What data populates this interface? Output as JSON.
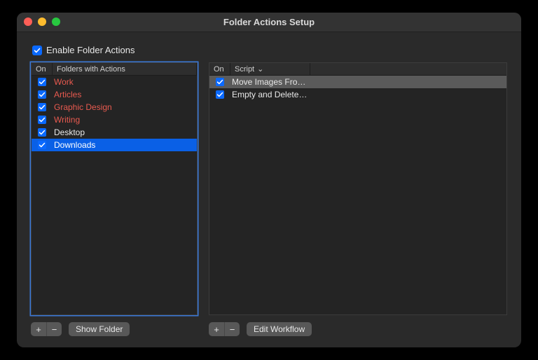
{
  "window": {
    "title": "Folder Actions Setup"
  },
  "enable": {
    "label": "Enable Folder Actions",
    "checked": true
  },
  "foldersTable": {
    "headers": {
      "on": "On",
      "name": "Folders with Actions"
    },
    "rows": [
      {
        "on": true,
        "name": "Work",
        "missing": true,
        "selected": false
      },
      {
        "on": true,
        "name": "Articles",
        "missing": true,
        "selected": false
      },
      {
        "on": true,
        "name": "Graphic Design",
        "missing": true,
        "selected": false
      },
      {
        "on": true,
        "name": "Writing",
        "missing": true,
        "selected": false
      },
      {
        "on": true,
        "name": "Desktop",
        "missing": false,
        "selected": false
      },
      {
        "on": true,
        "name": "Downloads",
        "missing": false,
        "selected": true
      }
    ]
  },
  "scriptsTable": {
    "headers": {
      "on": "On",
      "name": "Script"
    },
    "rows": [
      {
        "on": true,
        "name": "Move Images Fro…",
        "selected": true
      },
      {
        "on": true,
        "name": "Empty and Delete…",
        "selected": false
      }
    ]
  },
  "buttons": {
    "plus": "+",
    "minus": "−",
    "showFolder": "Show Folder",
    "editWorkflow": "Edit Workflow"
  }
}
